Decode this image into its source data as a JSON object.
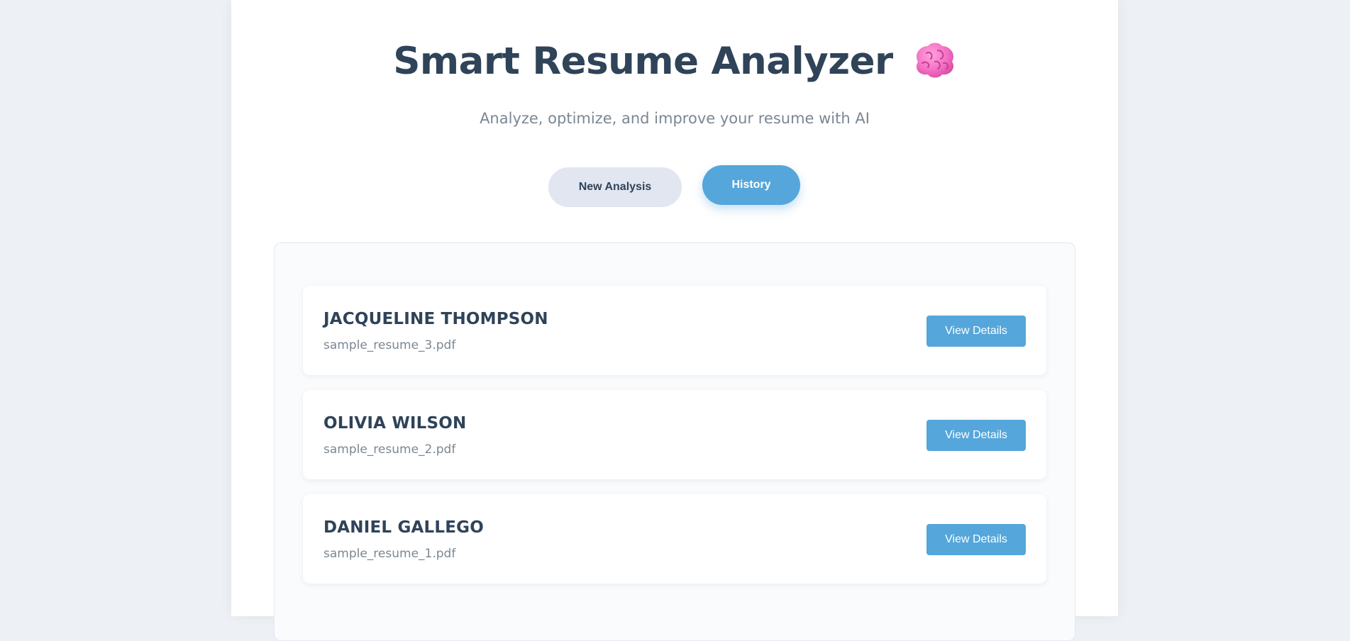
{
  "header": {
    "title": "Smart Resume Analyzer",
    "title_icon": "brain-icon",
    "subtitle": "Analyze, optimize, and improve your resume with AI"
  },
  "tabs": [
    {
      "label": "New Analysis",
      "active": false
    },
    {
      "label": "History",
      "active": true
    }
  ],
  "history": {
    "items": [
      {
        "name": "JACQUELINE THOMPSON",
        "file": "sample_resume_3.pdf",
        "action_label": "View Details"
      },
      {
        "name": "OLIVIA WILSON",
        "file": "sample_resume_2.pdf",
        "action_label": "View Details"
      },
      {
        "name": "DANIEL GALLEGO",
        "file": "sample_resume_1.pdf",
        "action_label": "View Details"
      }
    ]
  },
  "colors": {
    "accent": "#55a6da",
    "heading": "#2f4359",
    "muted": "#7b8793",
    "background": "#edf0f5",
    "brain": "#f472c4"
  }
}
